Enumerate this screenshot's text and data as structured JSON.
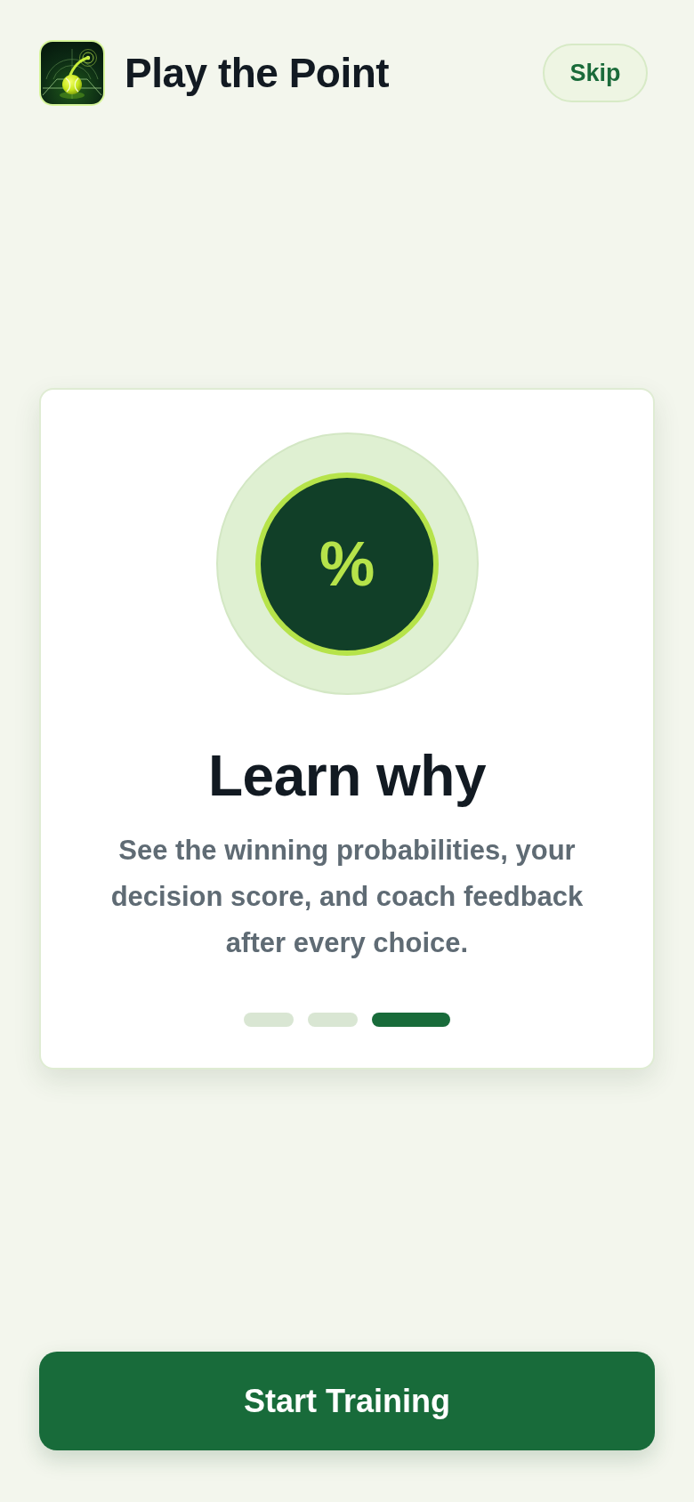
{
  "header": {
    "app_name": "Play the Point",
    "skip_button": "Skip"
  },
  "card": {
    "badge_symbol": "%",
    "title": "Learn why",
    "description": "See the winning probabilities, your decision score, and coach feedback after every choice.",
    "pagination": [
      {
        "selected": false
      },
      {
        "selected": false
      },
      {
        "selected": true
      }
    ]
  },
  "primary_button": "Start Training"
}
